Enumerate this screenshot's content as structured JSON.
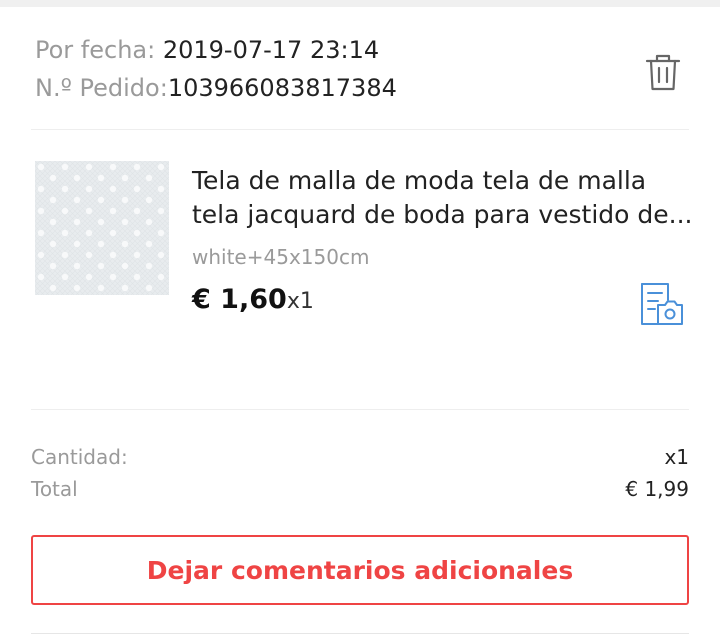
{
  "order": {
    "date_label": "Por fecha: ",
    "date_value": "2019-07-17 23:14",
    "order_label": "N.º Pedido:",
    "order_value": "103966083817384"
  },
  "icons": {
    "delete": "trash-icon",
    "snapshot": "order-snapshot-icon"
  },
  "product": {
    "title_line1": "Tela de malla de moda tela de malla",
    "title_line2": "tela jacquard de boda para vestido de...",
    "sku": "white+45x150cm",
    "price": "€ 1,60",
    "quantity": "x1"
  },
  "summary": {
    "quantity_label": "Cantidad:",
    "quantity_value": "x1",
    "total_label": "Total",
    "total_value": "€ 1,99"
  },
  "actions": {
    "feedback_label": "Dejar comentarios adicionales"
  },
  "colors": {
    "accent": "#ef4444",
    "icon_blue": "#4a90d9",
    "muted_text": "#9a9a9a"
  }
}
